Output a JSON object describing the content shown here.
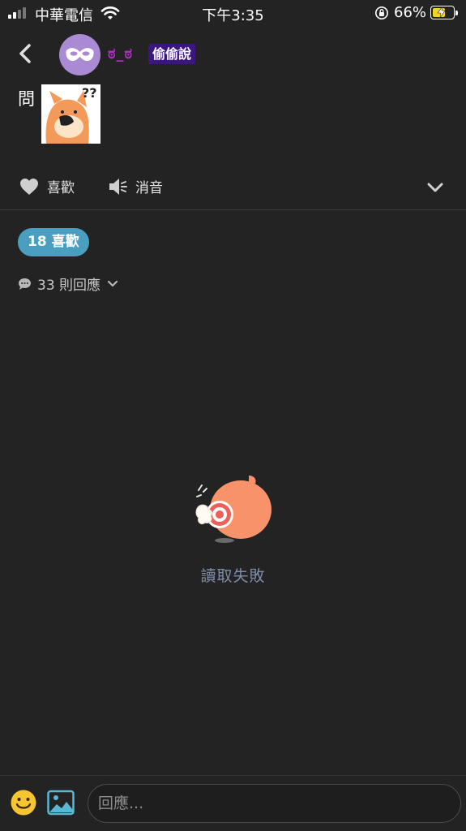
{
  "status_bar": {
    "carrier": "中華電信",
    "time": "下午3:35",
    "battery_percent": "66%",
    "battery_level": 0.66,
    "icons": [
      "signal-icon",
      "wifi-icon",
      "orientation-lock-icon",
      "battery-charging-icon"
    ]
  },
  "header": {
    "back_icon": "chevron-left-icon",
    "nickname": "ಠ_ಠ",
    "tag": "偷偷說"
  },
  "post": {
    "text": "問",
    "sticker_icon": "fox-thinking-sticker"
  },
  "actions": {
    "like_label": "喜歡",
    "mute_label": "消音",
    "more_icon": "chevron-down-icon"
  },
  "stats": {
    "likes": "18 喜歡",
    "replies": "33 則回應"
  },
  "error": {
    "message": "讀取失敗"
  },
  "composer": {
    "placeholder": "回應...",
    "emoji_icon": "emoji-icon",
    "image_icon": "image-icon"
  },
  "colors": {
    "background": "#232323",
    "accent": "#4a9fc0",
    "tag_bg": "#3b1680",
    "nickname": "#b02ec5",
    "error_text": "#7e8ca8"
  }
}
